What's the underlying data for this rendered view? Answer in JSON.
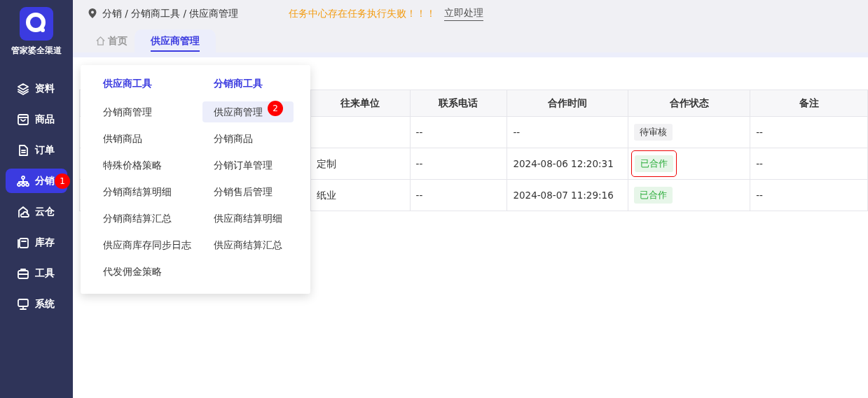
{
  "sidebar": {
    "brand": "管家婆全渠道",
    "items": [
      {
        "label": "资料",
        "selected": false
      },
      {
        "label": "商品",
        "selected": false
      },
      {
        "label": "订单",
        "selected": false
      },
      {
        "label": "分销",
        "selected": true,
        "badge": "1"
      },
      {
        "label": "云仓",
        "selected": false
      },
      {
        "label": "库存",
        "selected": false
      },
      {
        "label": "工具",
        "selected": false
      },
      {
        "label": "系统",
        "selected": false
      }
    ]
  },
  "breadcrumb": "分销 / 分销商工具 / 供应商管理",
  "alert": {
    "message": "任务中心存在任务执行失败！！！",
    "action": "立即处理"
  },
  "tabs": [
    {
      "label": "首页",
      "kind": "home",
      "selected": false
    },
    {
      "label": "供应商管理",
      "kind": "page",
      "selected": true
    }
  ],
  "menu": {
    "columns": [
      {
        "title": "供应商工具",
        "items": [
          {
            "label": "分销商管理",
            "selected": false
          },
          {
            "label": "供销商品",
            "selected": false
          },
          {
            "label": "特殊价格策略",
            "selected": false
          },
          {
            "label": "分销商结算明细",
            "selected": false
          },
          {
            "label": "分销商结算汇总",
            "selected": false
          },
          {
            "label": "供应商库存同步日志",
            "selected": false
          },
          {
            "label": "代发佣金策略",
            "selected": false
          }
        ]
      },
      {
        "title": "分销商工具",
        "items": [
          {
            "label": "供应商管理",
            "selected": true,
            "badge": "2"
          },
          {
            "label": "分销商品",
            "selected": false
          },
          {
            "label": "分销订单管理",
            "selected": false
          },
          {
            "label": "分销售后管理",
            "selected": false
          },
          {
            "label": "供应商结算明细",
            "selected": false
          },
          {
            "label": "供应商结算汇总",
            "selected": false
          }
        ]
      }
    ]
  },
  "table": {
    "columns": [
      "往来单位",
      "联系电话",
      "合作时间",
      "合作状态",
      "备注"
    ],
    "rows": [
      {
        "cells": [
          "",
          "--",
          "--"
        ],
        "status": {
          "label": "待审核",
          "kind": "pending",
          "highlighted": false
        },
        "note": "--"
      },
      {
        "cells": [
          "定制",
          "--",
          "2024-08-06 12:20:31"
        ],
        "status": {
          "label": "已合作",
          "kind": "active",
          "highlighted": true
        },
        "note": "--"
      },
      {
        "cells": [
          "纸业",
          "--",
          "2024-08-07 11:29:16"
        ],
        "status": {
          "label": "已合作",
          "kind": "active",
          "highlighted": false
        },
        "note": "--"
      }
    ]
  }
}
